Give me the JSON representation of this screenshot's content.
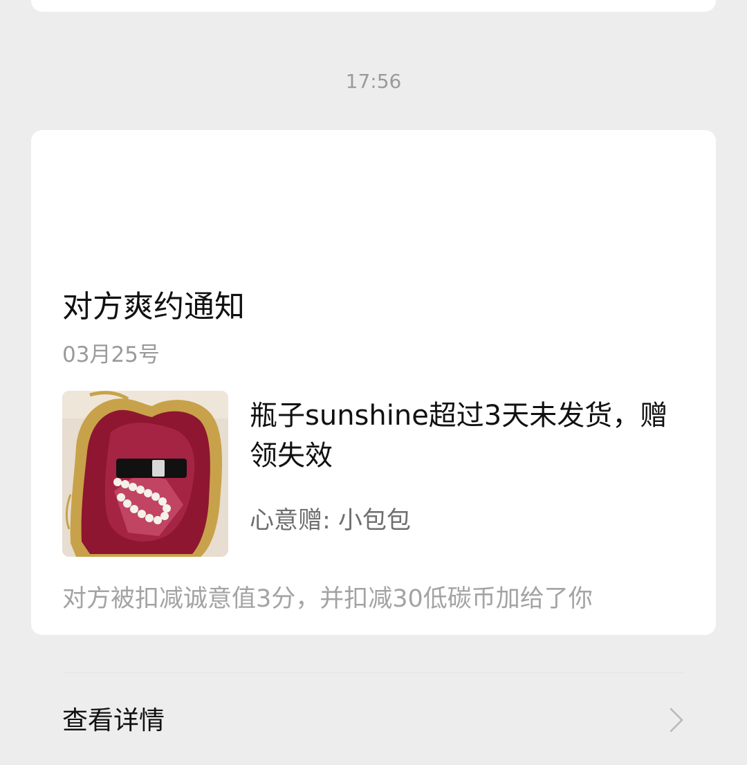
{
  "time_label": "17:56",
  "notice": {
    "title": "对方爽约通知",
    "date": "03月25号",
    "thumbnail": {
      "description_colors": {
        "velvet": "#9C1F3A",
        "gold": "#C8A24A",
        "pearl": "#F4F1EA"
      }
    },
    "headline": "瓶子sunshine超过3天未发货，赠领失效",
    "gift_text": "心意赠: 小包包",
    "penalty_text": "对方被扣减诚意值3分，并扣减30低碳币加给了你",
    "details_label": "查看详情",
    "details_icon": "chevron-right-icon"
  }
}
